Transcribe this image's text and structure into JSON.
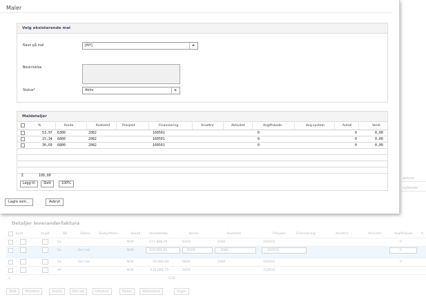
{
  "modal": {
    "title": "Maler",
    "select_section": {
      "title": "Velg eksisterende mal",
      "name_label": "Navn på mal",
      "name_value": "[NY]",
      "description_label": "Beskrivelse",
      "status_label": "Status",
      "required_mark": "*",
      "status_value": "Aktiv"
    },
    "details_section": {
      "title": "Maldetaljer",
      "columns": [
        "%",
        "Konto",
        "Koststed",
        "Prosjekt",
        "Finansiering",
        "Arsattnr",
        "Aktivitet",
        "Avgiftskode",
        "Avg.system",
        "Antall",
        "Verdi"
      ],
      "rows": [
        {
          "pct": "53,97",
          "konto": "6300",
          "koststed": "2082",
          "finansiering": "160501",
          "avgiftskode": "0",
          "antall": "0",
          "verdi": "0,00"
        },
        {
          "pct": "15,34",
          "konto": "6800",
          "koststed": "2082",
          "finansiering": "160501",
          "avgiftskode": "0",
          "antall": "0",
          "verdi": "0,00"
        },
        {
          "pct": "30,69",
          "konto": "6800",
          "koststed": "2082",
          "finansiering": "160501",
          "avgiftskode": "0",
          "antall": "0",
          "verdi": "0,00"
        }
      ],
      "sum_symbol": "Σ",
      "sum_value": "100,00",
      "add_button": "Legg til",
      "delete_button": "Slett",
      "percent_button": "100%"
    },
    "save_as_button": "Lagre som...",
    "cancel_button": "Avbryt"
  },
  "background": {
    "right_strip": [
      "aktura",
      "ngående"
    ],
    "panel_title": "Detaljer leverandørfaktura",
    "columns": [
      "Kont",
      "Avg/K",
      "BA",
      "Status",
      "Budsjettkon...",
      "Valuta",
      "Valutabeløp",
      "Konto",
      "Koststed",
      "Prosjekt",
      "Finansiering",
      "Arsattnr",
      "Aktivitet",
      "Avgiftskode",
      "A"
    ],
    "rows": [
      {
        "ba": "GL",
        "status": "",
        "valuta": "NOK",
        "amount": "173 888,79",
        "konto": "6300",
        "koststed": "2082",
        "fin": "160501",
        "avg": "0"
      },
      {
        "ba": "GL",
        "status": "Del rad",
        "valuta": "NOK",
        "amount": "100 000,00",
        "konto": "6500",
        "koststed": "2082",
        "fin": "160501",
        "avg": "0"
      },
      {
        "ba": "GL",
        "status": "Del rad",
        "valuta": "NOK",
        "amount": "50 000,00",
        "konto": "6800",
        "koststed": "2082",
        "fin": "160501",
        "avg": "0"
      },
      {
        "ba": "AP",
        "status": "",
        "valuta": "NOK",
        "amount": "-320 888,79",
        "konto": "2400",
        "koststed": "",
        "fin": "710910",
        "avg": ""
      }
    ],
    "sum_symbol": "Σ",
    "sum_value": "0,00",
    "buttons": [
      "Slett",
      "Attestere",
      "Avvise",
      "Del rad",
      "Informer",
      "Parker",
      "Videresend",
      "Angre"
    ]
  }
}
